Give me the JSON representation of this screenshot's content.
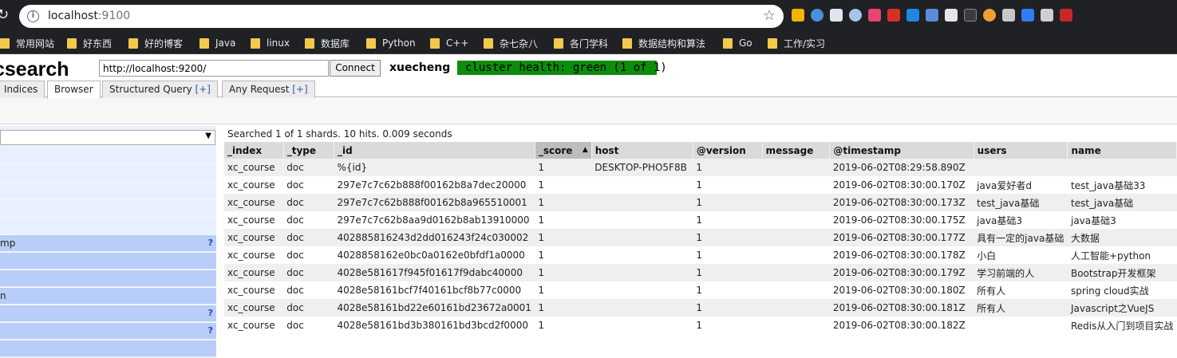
{
  "browser": {
    "url_host": "localhost",
    "url_port": ":9100"
  },
  "bookmarks": [
    "常用网站",
    "好东西",
    "好的博客",
    "Java",
    "linux",
    "数据库",
    "Python",
    "C++",
    "杂七杂八",
    "各门学科",
    "数据结构和算法",
    "Go",
    "工作/实习"
  ],
  "header": {
    "title": "csearch",
    "es_url": "http://localhost:9200/",
    "connect_label": "Connect",
    "cluster_name": "xuecheng",
    "health": "cluster health: green (1 of 1)",
    "health_color": "#0c8d0c"
  },
  "tabs": [
    {
      "label": "Indices",
      "plus": ""
    },
    {
      "label": "Browser",
      "plus": ""
    },
    {
      "label": "Structured Query ",
      "plus": "[+]"
    },
    {
      "label": "Any Request ",
      "plus": "[+]"
    }
  ],
  "left_panel": {
    "rows": [
      {
        "label": "",
        "hint": ""
      },
      {
        "label": "",
        "hint": ""
      },
      {
        "label": "",
        "hint": ""
      },
      {
        "label": "",
        "hint": ""
      },
      {
        "label": "",
        "hint": ""
      },
      {
        "label": "mp",
        "hint": "?"
      },
      {
        "label": "",
        "hint": ""
      },
      {
        "label": "",
        "hint": ""
      },
      {
        "label": "n",
        "hint": ""
      },
      {
        "label": "",
        "hint": "?"
      },
      {
        "label": "",
        "hint": "?"
      },
      {
        "label": "",
        "hint": ""
      }
    ]
  },
  "results": {
    "summary": "Searched 1 of 1 shards. 10 hits. 0.009 seconds",
    "columns": [
      "_index",
      "_type",
      "_id",
      "_score",
      "host",
      "@version",
      "message",
      "@timestamp",
      "users",
      "name"
    ],
    "sorted_column": "_score",
    "sort_arrow": "▲",
    "rows": [
      [
        "xc_course",
        "doc",
        "%{id}",
        "1",
        "DESKTOP-PHO5F8B",
        "1",
        "",
        "2019-06-02T08:29:58.890Z",
        "",
        ""
      ],
      [
        "xc_course",
        "doc",
        "297e7c7c62b888f00162b8a7dec20000",
        "1",
        "",
        "1",
        "",
        "2019-06-02T08:30:00.170Z",
        "java爱好者d",
        "test_java基础33"
      ],
      [
        "xc_course",
        "doc",
        "297e7c7c62b888f00162b8a965510001",
        "1",
        "",
        "1",
        "",
        "2019-06-02T08:30:00.173Z",
        "test_java基础",
        "test_java基础"
      ],
      [
        "xc_course",
        "doc",
        "297e7c7c62b8aa9d0162b8ab13910000",
        "1",
        "",
        "1",
        "",
        "2019-06-02T08:30:00.175Z",
        "java基础3",
        "java基础3"
      ],
      [
        "xc_course",
        "doc",
        "402885816243d2dd016243f24c030002",
        "1",
        "",
        "1",
        "",
        "2019-06-02T08:30:00.177Z",
        "具有一定的java基础",
        "大数据"
      ],
      [
        "xc_course",
        "doc",
        "4028858162e0bc0a0162e0bfdf1a0000",
        "1",
        "",
        "1",
        "",
        "2019-06-02T08:30:00.178Z",
        "小白",
        "人工智能+python"
      ],
      [
        "xc_course",
        "doc",
        "4028e581617f945f01617f9dabc40000",
        "1",
        "",
        "1",
        "",
        "2019-06-02T08:30:00.179Z",
        "学习前端的人",
        "Bootstrap开发框架"
      ],
      [
        "xc_course",
        "doc",
        "4028e58161bcf7f40161bcf8b77c0000",
        "1",
        "",
        "1",
        "",
        "2019-06-02T08:30:00.180Z",
        "所有人",
        "spring cloud实战"
      ],
      [
        "xc_course",
        "doc",
        "4028e58161bd22e60161bd23672a0001",
        "1",
        "",
        "1",
        "",
        "2019-06-02T08:30:00.181Z",
        "所有人",
        "Javascript之VueJS"
      ],
      [
        "xc_course",
        "doc",
        "4028e58161bd3b380161bd3bcd2f0000",
        "1",
        "",
        "1",
        "",
        "2019-06-02T08:30:00.182Z",
        "",
        "Redis从入门到项目实战"
      ]
    ]
  }
}
